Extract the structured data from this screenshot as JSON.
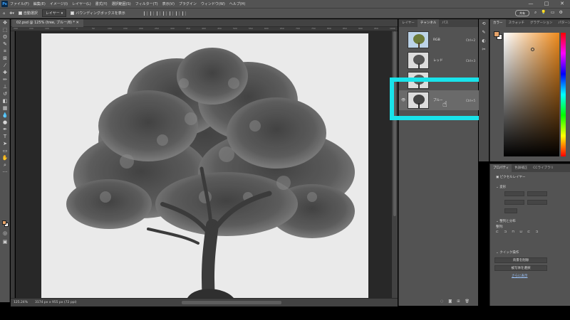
{
  "title_bar": {
    "menus": [
      "ファイル(F)",
      "編集(E)",
      "イメージ(I)",
      "レイヤー(L)",
      "書式(Y)",
      "選択範囲(S)",
      "フィルター(T)",
      "表示(V)",
      "プラグイン",
      "ウィンドウ(W)",
      "ヘルプ(H)"
    ],
    "window_controls": [
      "—",
      "□",
      "✕"
    ]
  },
  "options_bar": {
    "auto_select_label": "自動選択",
    "auto_select_target": "レイヤー",
    "bounding_box_label": "バウンディングボックスを表示",
    "share_label": "共有"
  },
  "document": {
    "tab_label": "02.psd @ 125% (tree, ブルー/8) *",
    "ruler_marks": [
      "200",
      "150",
      "100",
      "50",
      "0",
      "50",
      "100",
      "150",
      "200",
      "250",
      "300",
      "350",
      "400",
      "450",
      "500",
      "550",
      "600",
      "650",
      "700",
      "750",
      "800",
      "850",
      "900",
      "950",
      "1000"
    ],
    "zoom": "125.24%",
    "dimensions": "3174 px x 955 px (72 ppi)"
  },
  "channels_panel": {
    "tabs": [
      "レイヤー",
      "チャンネル",
      "パス"
    ],
    "active_tab": "チャンネル",
    "channels": [
      {
        "name": "RGB",
        "shortcut": "Ctrl+2",
        "visible": false
      },
      {
        "name": "レッド",
        "shortcut": "Ctrl+3",
        "visible": false
      },
      {
        "name": "",
        "shortcut": "",
        "visible": false
      },
      {
        "name": "ブルー",
        "shortcut": "Ctrl+5",
        "visible": true,
        "selected": true
      }
    ]
  },
  "color_panel": {
    "tabs": [
      "カラー",
      "スウォッチ",
      "グラデーション",
      "パターン"
    ],
    "active_tab": "カラー",
    "foreground_color": "#e6a36a",
    "background_color": "#ffffff"
  },
  "properties_panel": {
    "tabs": [
      "プロパティ",
      "色調補正",
      "CCライブラリ"
    ],
    "active_tab": "プロパティ",
    "layer_type": "ピクセルレイヤー",
    "transform_heading": "変形",
    "align_heading": "整列と分布",
    "align_sub": "整列:",
    "quick_actions_heading": "クイック操作",
    "btn_remove_bg": "背景を削除",
    "btn_select_subject": "被写体を選択",
    "more_link": "さらに表示"
  },
  "colors": {
    "highlight": "#19e3ea",
    "ui_panel": "#535353",
    "canvas_bg": "#282828"
  }
}
